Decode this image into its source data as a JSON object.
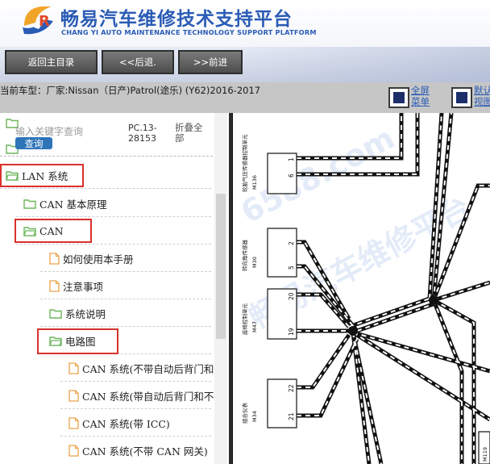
{
  "header": {
    "title": "畅易汽车维修技术支持平台",
    "subtitle": "CHANG YI AUTO MAINTENANCE TECHNOLOGY SUPPORT PLATFORM"
  },
  "toolbar": {
    "home_label": "返回主目录",
    "back_label": "<<后退.",
    "forward_label": ">>前进"
  },
  "model": {
    "text": "当前车型：厂家:Nissan（日产)Patrol(途乐) (Y62)2016-2017",
    "fullscreen_label": "全屏菜单",
    "dual_label": "默认视图"
  },
  "search": {
    "placeholder": "输入关键字查询",
    "button_label": "查询",
    "pc_code": "PC.13-28153",
    "collapse_label": "折叠全部"
  },
  "tree": [
    {
      "label": "LAN 系统",
      "type": "folder",
      "highlighted": true
    },
    {
      "label": "CAN 基本原理",
      "type": "folder",
      "highlighted": false
    },
    {
      "label": "CAN",
      "type": "folder",
      "highlighted": true
    },
    {
      "label": "如何使用本手册",
      "type": "doc",
      "highlighted": false
    },
    {
      "label": "注意事项",
      "type": "doc",
      "highlighted": false
    },
    {
      "label": "系统说明",
      "type": "folder",
      "highlighted": false
    },
    {
      "label": "电路图",
      "type": "folder",
      "highlighted": true
    },
    {
      "label": "CAN 系统(不带自动后背门和",
      "type": "doc",
      "highlighted": false
    },
    {
      "label": "CAN 系统(带自动后背门和不",
      "type": "doc",
      "highlighted": false
    },
    {
      "label": "CAN 系统(带 ICC)",
      "type": "doc",
      "highlighted": false
    },
    {
      "label": "CAN 系统(不带 CAN 网关)",
      "type": "doc",
      "highlighted": false
    }
  ],
  "diagram": {
    "watermark": "畅易汽车维修平台",
    "watermark2": "6588.com",
    "components": [
      {
        "label": "轮胎气压传感器控制单元",
        "code": "M136",
        "pins": [
          "1",
          "6"
        ]
      },
      {
        "label": "转向角传感器",
        "code": "M30",
        "pins": [
          "2",
          "5"
        ]
      },
      {
        "label": "座椅控制单元",
        "code": "M47",
        "pins": [
          "20",
          "19"
        ]
      },
      {
        "label": "组合仪表",
        "code": "M34",
        "pins": [
          "22",
          "21"
        ]
      }
    ],
    "right_code": "M119"
  },
  "colors": {
    "brand": "#2a5bb6",
    "toolbar_button": "#5f5f5f",
    "highlight": "#d9312c",
    "folder": "#6cb65c",
    "doc": "#e9a24a"
  }
}
